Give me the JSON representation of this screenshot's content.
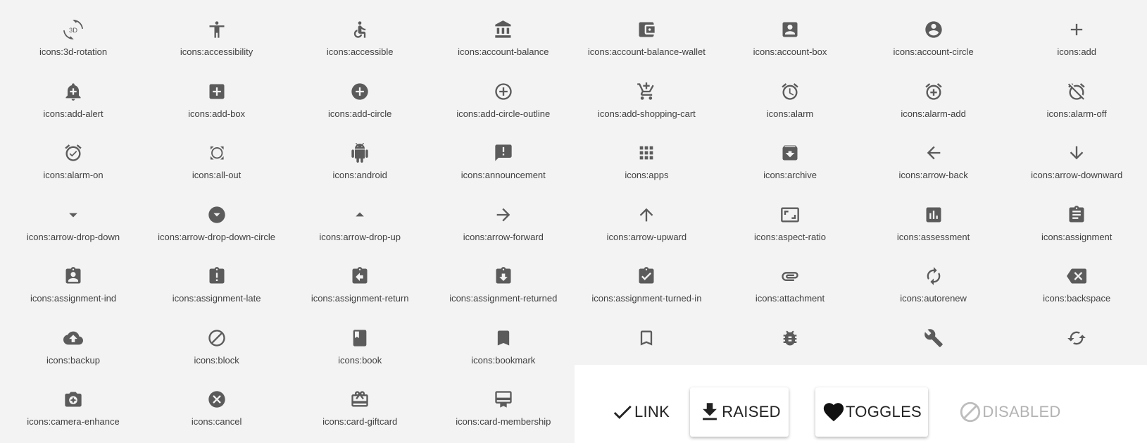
{
  "icon_grid": [
    {
      "label": "icons:3d-rotation",
      "icon": "3d-rotation"
    },
    {
      "label": "icons:accessibility",
      "icon": "accessibility"
    },
    {
      "label": "icons:accessible",
      "icon": "accessible"
    },
    {
      "label": "icons:account-balance",
      "icon": "account-balance"
    },
    {
      "label": "icons:account-balance-wallet",
      "icon": "account-balance-wallet"
    },
    {
      "label": "icons:account-box",
      "icon": "account-box"
    },
    {
      "label": "icons:account-circle",
      "icon": "account-circle"
    },
    {
      "label": "icons:add",
      "icon": "add"
    },
    {
      "label": "icons:add-alert",
      "icon": "add-alert"
    },
    {
      "label": "icons:add-box",
      "icon": "add-box"
    },
    {
      "label": "icons:add-circle",
      "icon": "add-circle"
    },
    {
      "label": "icons:add-circle-outline",
      "icon": "add-circle-outline"
    },
    {
      "label": "icons:add-shopping-cart",
      "icon": "add-shopping-cart"
    },
    {
      "label": "icons:alarm",
      "icon": "alarm"
    },
    {
      "label": "icons:alarm-add",
      "icon": "alarm-add"
    },
    {
      "label": "icons:alarm-off",
      "icon": "alarm-off"
    },
    {
      "label": "icons:alarm-on",
      "icon": "alarm-on"
    },
    {
      "label": "icons:all-out",
      "icon": "all-out"
    },
    {
      "label": "icons:android",
      "icon": "android"
    },
    {
      "label": "icons:announcement",
      "icon": "announcement"
    },
    {
      "label": "icons:apps",
      "icon": "apps"
    },
    {
      "label": "icons:archive",
      "icon": "archive"
    },
    {
      "label": "icons:arrow-back",
      "icon": "arrow-back"
    },
    {
      "label": "icons:arrow-downward",
      "icon": "arrow-downward"
    },
    {
      "label": "icons:arrow-drop-down",
      "icon": "arrow-drop-down"
    },
    {
      "label": "icons:arrow-drop-down-circle",
      "icon": "arrow-drop-down-circle"
    },
    {
      "label": "icons:arrow-drop-up",
      "icon": "arrow-drop-up"
    },
    {
      "label": "icons:arrow-forward",
      "icon": "arrow-forward"
    },
    {
      "label": "icons:arrow-upward",
      "icon": "arrow-upward"
    },
    {
      "label": "icons:aspect-ratio",
      "icon": "aspect-ratio"
    },
    {
      "label": "icons:assessment",
      "icon": "assessment"
    },
    {
      "label": "icons:assignment",
      "icon": "assignment"
    },
    {
      "label": "icons:assignment-ind",
      "icon": "assignment-ind"
    },
    {
      "label": "icons:assignment-late",
      "icon": "assignment-late"
    },
    {
      "label": "icons:assignment-return",
      "icon": "assignment-return"
    },
    {
      "label": "icons:assignment-returned",
      "icon": "assignment-returned"
    },
    {
      "label": "icons:assignment-turned-in",
      "icon": "assignment-turned-in"
    },
    {
      "label": "icons:attachment",
      "icon": "attachment"
    },
    {
      "label": "icons:autorenew",
      "icon": "autorenew"
    },
    {
      "label": "icons:backspace",
      "icon": "backspace"
    },
    {
      "label": "icons:backup",
      "icon": "backup"
    },
    {
      "label": "icons:block",
      "icon": "block"
    },
    {
      "label": "icons:book",
      "icon": "book"
    },
    {
      "label": "icons:bookmark",
      "icon": "bookmark"
    },
    {
      "label": "",
      "icon": "bookmark-border"
    },
    {
      "label": "",
      "icon": "bug-report"
    },
    {
      "label": "",
      "icon": "build"
    },
    {
      "label": "",
      "icon": "cached"
    },
    {
      "label": "icons:camera-enhance",
      "icon": "camera-enhance"
    },
    {
      "label": "icons:cancel",
      "icon": "cancel"
    },
    {
      "label": "icons:card-giftcard",
      "icon": "card-giftcard"
    },
    {
      "label": "icons:card-membership",
      "icon": "card-membership"
    }
  ],
  "buttons": [
    {
      "id": "link",
      "label": "LINK",
      "icon": "check-icon",
      "style": "flat"
    },
    {
      "id": "raised",
      "label": "RAISED",
      "icon": "file-download-icon",
      "style": "raised"
    },
    {
      "id": "toggles",
      "label": "TOGGLES",
      "icon": "favorite-icon",
      "style": "raised"
    },
    {
      "id": "disabled",
      "label": "DISABLED",
      "icon": "block-icon",
      "style": "disabled"
    }
  ],
  "colors": {
    "page_background": "#f3f3f3",
    "icon": "#5b5b5b",
    "label": "#404040",
    "button_text": "#222222",
    "disabled_text": "#b3b3b3"
  }
}
